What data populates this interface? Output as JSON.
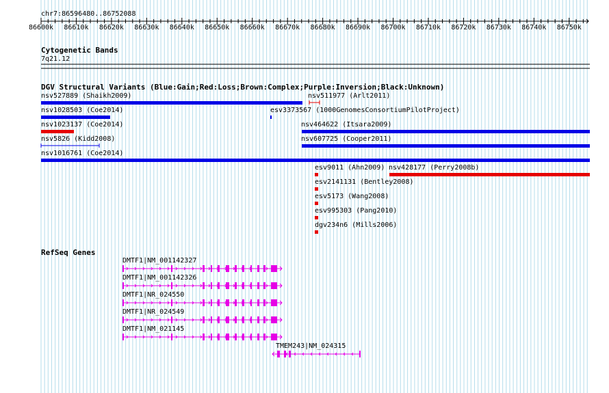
{
  "region": "chr7:86596480..86752088",
  "ruler": {
    "ticks": [
      "86600k",
      "86610k",
      "86620k",
      "86630k",
      "86640k",
      "86650k",
      "86660k",
      "86670k",
      "86680k",
      "86690k",
      "86700k",
      "86710k",
      "86720k",
      "86730k",
      "86740k",
      "86750k"
    ]
  },
  "cytoband": {
    "title": "Cytogenetic Bands",
    "band": "7q21.12"
  },
  "dgv": {
    "title": "DGV Structural Variants (Blue:Gain;Red:Loss;Brown:Complex;Purple:Inversion;Black:Unknown)",
    "colors": {
      "gain": "#0000e6",
      "loss": "#e60000"
    },
    "features": [
      {
        "label": "nsv527889 (Shaikh2009)",
        "type": "gain"
      },
      {
        "label": "nsv511977 (Arlt2011)",
        "type": "loss"
      },
      {
        "label": "nsv1028503 (Coe2014)",
        "type": "gain"
      },
      {
        "label": "esv3373567 (1000GenomesConsortiumPilotProject)",
        "type": "gain"
      },
      {
        "label": "nsv1023137 (Coe2014)",
        "type": "loss"
      },
      {
        "label": "nsv464622 (Itsara2009)",
        "type": "gain"
      },
      {
        "label": "nsv5826 (Kidd2008)",
        "type": "gain"
      },
      {
        "label": "nsv607725 (Cooper2011)",
        "type": "gain"
      },
      {
        "label": "nsv1016761 (Coe2014)",
        "type": "gain"
      },
      {
        "label": "esv9011 (Ahn2009)",
        "type": "loss"
      },
      {
        "label": "nsv428177 (Perry2008b)",
        "type": "loss"
      },
      {
        "label": "esv2141131 (Bentley2008)",
        "type": "loss"
      },
      {
        "label": "esv5173 (Wang2008)",
        "type": "loss"
      },
      {
        "label": "esv995303 (Pang2010)",
        "type": "loss"
      },
      {
        "label": "dgv234n6 (Mills2006)",
        "type": "loss"
      }
    ]
  },
  "refseq": {
    "title": "RefSeq Genes",
    "color": "#e600e6",
    "genes": [
      {
        "label": "DMTF1|NM_001142327"
      },
      {
        "label": "DMTF1|NM_001142326"
      },
      {
        "label": "DMTF1|NR_024550"
      },
      {
        "label": "DMTF1|NR_024549"
      },
      {
        "label": "DMTF1|NM_021145"
      },
      {
        "label": "TMEM243|NM_024315"
      }
    ]
  }
}
